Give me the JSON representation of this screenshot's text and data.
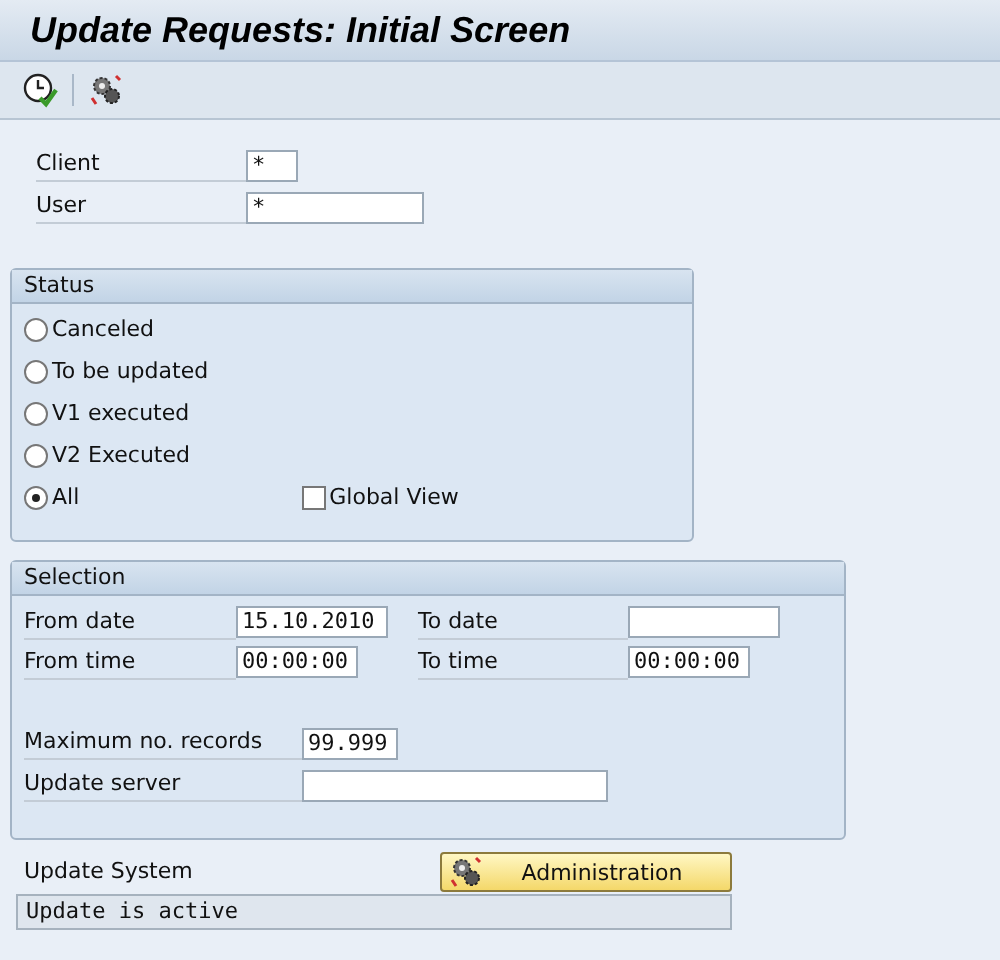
{
  "window": {
    "title": "Update Requests: Initial Screen"
  },
  "toolbar": {
    "buttons": [
      {
        "kind": "execute"
      },
      {
        "kind": "gears"
      }
    ]
  },
  "header_fields": [
    {
      "label": "Client",
      "value": "*"
    },
    {
      "label": "User",
      "value": "*"
    }
  ],
  "status": {
    "title": "Status",
    "options": [
      {
        "label": "Canceled",
        "selected": false
      },
      {
        "label": "To be updated",
        "selected": false
      },
      {
        "label": "V1 executed",
        "selected": false
      },
      {
        "label": "V2 Executed",
        "selected": false
      },
      {
        "label": "All",
        "selected": true
      }
    ],
    "global_view": {
      "label": "Global View",
      "checked": false
    }
  },
  "selection": {
    "title": "Selection",
    "from_date": {
      "label": "From date",
      "value": "15.10.2010"
    },
    "to_date": {
      "label": "To date"
    },
    "from_time": {
      "label": "From time",
      "value": "00:00:00"
    },
    "to_time": {
      "label": "To time",
      "value": "00:00:00"
    },
    "max_records": {
      "label": "Maximum no. records",
      "value": "99.999"
    },
    "update_server": {
      "label": "Update server"
    }
  },
  "update_system": {
    "label": "Update System",
    "button": "Administration",
    "message": "Update is active"
  }
}
